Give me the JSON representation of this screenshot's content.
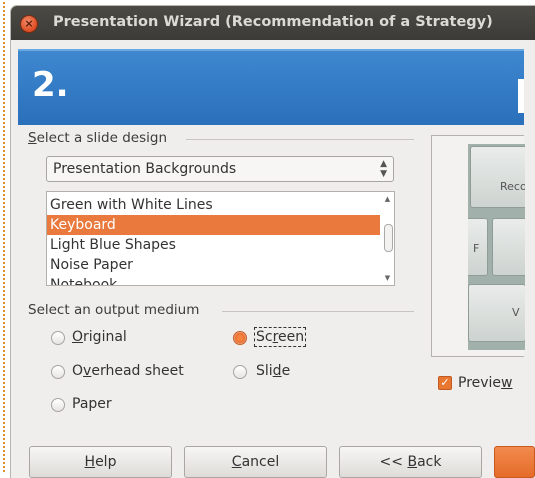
{
  "window": {
    "title": "Presentation Wizard (Recommendation of a Strategy)"
  },
  "banner": {
    "step": "2."
  },
  "slide_design": {
    "group_label_accel": "S",
    "group_label_rest": "elect a slide design",
    "category": "Presentation Backgrounds",
    "items": [
      {
        "label": "Green with White Lines",
        "selected": false
      },
      {
        "label": "Keyboard",
        "selected": true
      },
      {
        "label": "Light Blue Shapes",
        "selected": false
      },
      {
        "label": "Noise Paper",
        "selected": false
      },
      {
        "label": "Notebook",
        "selected": false
      }
    ]
  },
  "output_medium": {
    "group_label": "Select an output medium",
    "options": {
      "original": {
        "accel": "O",
        "rest": "riginal",
        "selected": false
      },
      "overhead": {
        "pre": "O",
        "accel": "v",
        "rest": "erhead sheet",
        "selected": false
      },
      "paper": {
        "label": "Paper",
        "selected": false
      },
      "screen": {
        "pre": "Sc",
        "accel": "r",
        "rest": "een",
        "selected": true
      },
      "slide": {
        "pre": "Sli",
        "accel": "d",
        "rest": "e",
        "selected": false
      }
    }
  },
  "preview": {
    "checkbox_pre": "Previe",
    "checkbox_accel": "w",
    "checked": true,
    "keys": {
      "top": "Reco",
      "mid": "F",
      "bottom": "V"
    }
  },
  "buttons": {
    "help": {
      "accel": "H",
      "rest": "elp"
    },
    "cancel": {
      "accel": "C",
      "rest": "ancel"
    },
    "back": {
      "pre": "<< ",
      "accel": "B",
      "rest": "ack"
    }
  },
  "colors": {
    "accent": "#e9793d",
    "banner": "#2f78c4",
    "titlebar": "#3c3b37"
  }
}
